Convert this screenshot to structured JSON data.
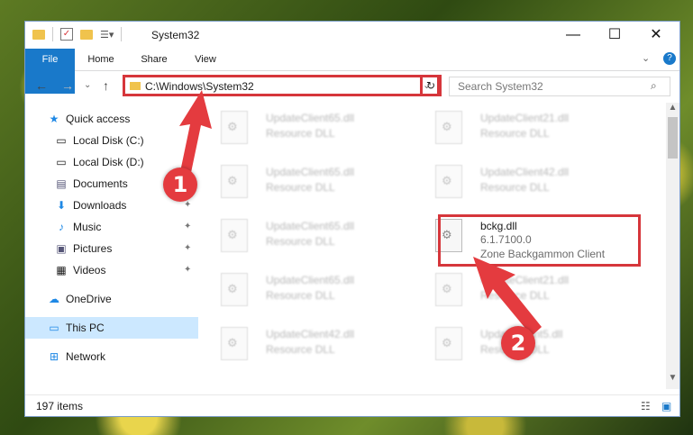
{
  "window": {
    "title": "System32",
    "controls": {
      "minimize": "—",
      "maximize": "☐",
      "close": "✕"
    }
  },
  "ribbon": {
    "tabs": [
      "File",
      "Home",
      "Share",
      "View"
    ],
    "help": "?"
  },
  "address": {
    "path": "C:\\Windows\\System32",
    "search_placeholder": "Search System32"
  },
  "sidebar": {
    "items": [
      {
        "label": "Quick access",
        "icon": "star-icon"
      },
      {
        "label": "Local Disk (C:)",
        "icon": "drive-icon"
      },
      {
        "label": "Local Disk (D:)",
        "icon": "drive-icon"
      },
      {
        "label": "Documents",
        "icon": "document-icon"
      },
      {
        "label": "Downloads",
        "icon": "download-icon"
      },
      {
        "label": "Music",
        "icon": "music-icon"
      },
      {
        "label": "Pictures",
        "icon": "pictures-icon"
      },
      {
        "label": "Videos",
        "icon": "videos-icon"
      },
      {
        "label": "OneDrive",
        "icon": "cloud-icon"
      },
      {
        "label": "This PC",
        "icon": "computer-icon"
      },
      {
        "label": "Network",
        "icon": "network-icon"
      }
    ]
  },
  "files": {
    "left": [
      {
        "name": "UpdateClient65.dll",
        "desc": "Resource DLL"
      },
      {
        "name": "UpdateClient65.dll",
        "desc": "Resource DLL"
      },
      {
        "name": "UpdateClient65.dll",
        "desc": "Resource DLL"
      },
      {
        "name": "UpdateClient65.dll",
        "desc": "Resource DLL"
      },
      {
        "name": "UpdateClient42.dll",
        "desc": "Resource DLL"
      }
    ],
    "right": [
      {
        "name": "UpdateClient21.dll",
        "desc": "Resource DLL"
      },
      {
        "name": "UpdateClient42.dll",
        "desc": "Resource DLL"
      },
      {
        "name": "bckg.dll",
        "version": "6.1.7100.0",
        "desc": "Zone Backgammon Client"
      },
      {
        "name": "UpdateClient21.dll",
        "desc": "Resource DLL"
      },
      {
        "name": "UpdateClient5.dll",
        "desc": "Resource DLL"
      }
    ]
  },
  "status": {
    "count": "197 items"
  },
  "annotations": {
    "step1": "1",
    "step2": "2"
  }
}
